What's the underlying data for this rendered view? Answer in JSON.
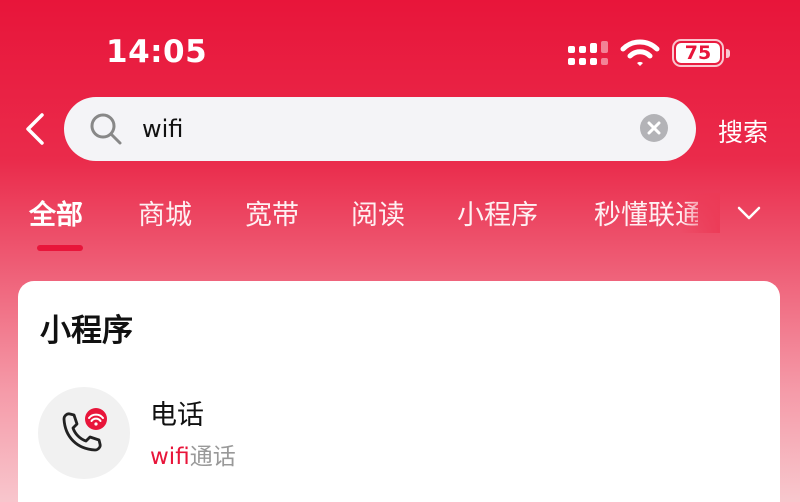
{
  "status_bar": {
    "time": "14:05",
    "battery_level": "75",
    "icons": [
      "signal-icon",
      "wifi-icon",
      "battery-icon"
    ]
  },
  "search": {
    "query": "wifi",
    "submit_label": "搜索",
    "icons": [
      "back-icon",
      "search-icon",
      "clear-icon"
    ]
  },
  "tabs": {
    "items": [
      {
        "label": "全部",
        "active": true
      },
      {
        "label": "商城",
        "active": false
      },
      {
        "label": "宽带",
        "active": false
      },
      {
        "label": "阅读",
        "active": false
      },
      {
        "label": "小程序",
        "active": false
      },
      {
        "label": "秒懂联通",
        "active": false
      }
    ],
    "more_icon": "chevron-down-icon"
  },
  "section": {
    "title": "小程序",
    "items": [
      {
        "name": "电话",
        "desc_highlight": "wifi",
        "desc_rest": "通话",
        "icon": "phone-wifi-icon"
      }
    ]
  },
  "colors": {
    "brand": "#e8153a",
    "white": "#ffffff",
    "muted_text": "#999999",
    "search_bg": "#f4f4f7"
  }
}
